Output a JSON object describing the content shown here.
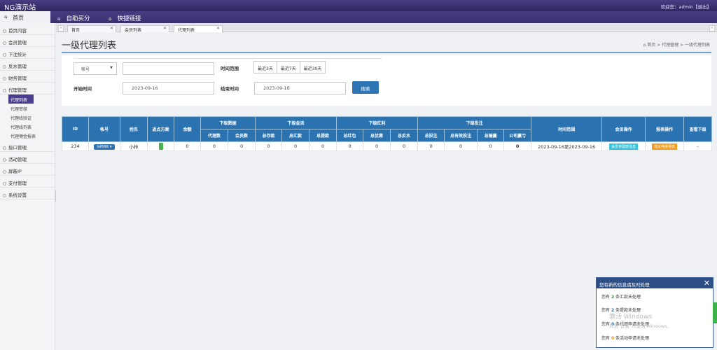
{
  "header": {
    "brand": "NG演示站",
    "welcome": "欢迎您：admin【退出】"
  },
  "nav": {
    "home": "首页",
    "items": [
      "自助买分",
      "快捷链接"
    ]
  },
  "sidebar": {
    "items": [
      "首页内容",
      "会员管理",
      "下注统计",
      "反水管理",
      "财务管理",
      "代理管理"
    ],
    "agent_sub": [
      "代理列表",
      "代理审核",
      "代理线验证",
      "代理线列表",
      "代理佣金报表"
    ],
    "items_after": [
      "接口管理",
      "活动管理",
      "屏蔽IP",
      "支付管理",
      "系统设置"
    ]
  },
  "tabs": [
    "首页",
    "会员列表",
    "代理列表"
  ],
  "page": {
    "title": "一级代理列表",
    "breadcrumb": [
      "首页",
      "代理管理",
      "一级代理列表"
    ]
  },
  "search": {
    "field_select": "帐号",
    "keyword_value": "",
    "time_range_label": "时间范围",
    "ranges": [
      "最近3天",
      "最近7天",
      "最近30天"
    ],
    "start_label": "开始时间",
    "start_value": "2023-09-16",
    "end_label": "结束时间",
    "end_value": "2023-09-16",
    "button": "搜索"
  },
  "table": {
    "headers_top": {
      "id": "ID",
      "account": "帐号",
      "name": "姓名",
      "plan": "返点方案",
      "balance": "余额",
      "g_data": "下级数据",
      "g_funds": "下级金流",
      "g_bonus": "下级红利",
      "g_bets": "下级投注",
      "range": "时间范围",
      "member_ops": "会员操作",
      "report_ops": "报表操作",
      "view_sub": "查看下级"
    },
    "headers_sub": [
      "代理数",
      "会员数",
      "总存款",
      "总汇款",
      "总提款",
      "总红包",
      "总优惠",
      "总反水",
      "总投注",
      "总有效投注",
      "总输赢",
      "公司赢亏"
    ],
    "rows": [
      {
        "id": "234",
        "account": "lsf666",
        "name": "小林",
        "balance": "0",
        "agents": "0",
        "members": "0",
        "deposit": "0",
        "remit": "0",
        "withdraw": "0",
        "redpack": "0",
        "promo": "0",
        "rebate": "0",
        "bets": "0",
        "valid_bets": "0",
        "winloss": "0",
        "company": "0",
        "range": "2023-09-16至2023-09-16",
        "member_op": "会员存取款信息",
        "report_op": "流水佣金报表",
        "view_sub": "-"
      }
    ]
  },
  "notice": {
    "title": "您有新的信息请及时处理",
    "lines": [
      {
        "pre": "您有",
        "count": "2",
        "post": "条汇款未处理"
      },
      {
        "pre": "您有",
        "count": "2",
        "post": "条提款未处理"
      },
      {
        "pre": "您有",
        "count": "0",
        "post": "条代理申请未处理"
      },
      {
        "pre": "您有",
        "count": "0",
        "post": "条活动申请未处理"
      }
    ]
  },
  "watermark": {
    "line1": "激活 Windows",
    "line2": "转到\"设置\"以激活 Windows。"
  }
}
